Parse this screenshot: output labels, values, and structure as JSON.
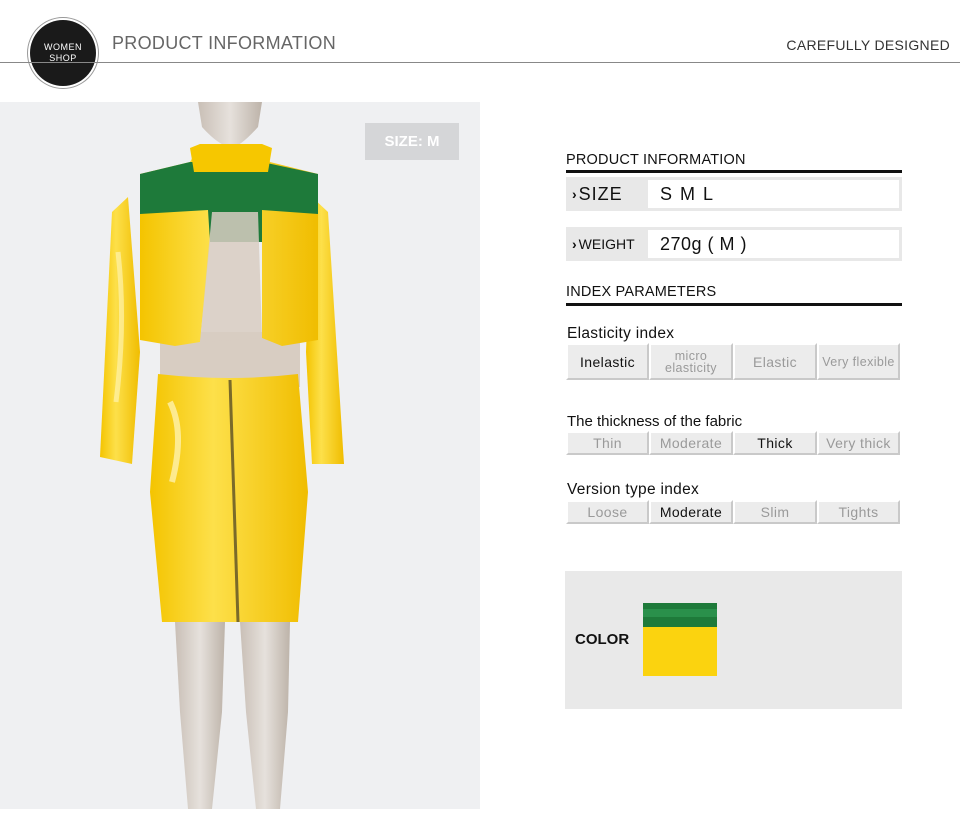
{
  "header": {
    "logo_line1": "WOMEN",
    "logo_line2": "SHOP",
    "title": "PRODUCT INFORMATION",
    "tagline": "CAREFULLY DESIGNED"
  },
  "photo": {
    "size_badge": "SIZE: M",
    "garment_colors": {
      "body": "#fbd30f",
      "panel": "#1e7a3a"
    }
  },
  "product_info": {
    "title": "PRODUCT INFORMATION",
    "size_label": "SIZE",
    "size_value": "S M L",
    "weight_label": "WEIGHT",
    "weight_value": "270g ( M )"
  },
  "index_parameters": {
    "title": "INDEX PARAMETERS",
    "elasticity": {
      "label": "Elasticity index",
      "options": [
        "Inelastic",
        "micro elasticity",
        "Elastic",
        "Very flexible"
      ],
      "selected": "Inelastic"
    },
    "thickness": {
      "label": "The thickness of the fabric",
      "options": [
        "Thin",
        "Moderate",
        "Thick",
        "Very thick"
      ],
      "selected": "Thick"
    },
    "version": {
      "label": "Version type index",
      "options": [
        "Loose",
        "Moderate",
        "Slim",
        "Tights"
      ],
      "selected": "Moderate"
    }
  },
  "color": {
    "label": "COLOR",
    "swatch_colors": [
      "#1e7a3a",
      "#fbd30f"
    ]
  }
}
